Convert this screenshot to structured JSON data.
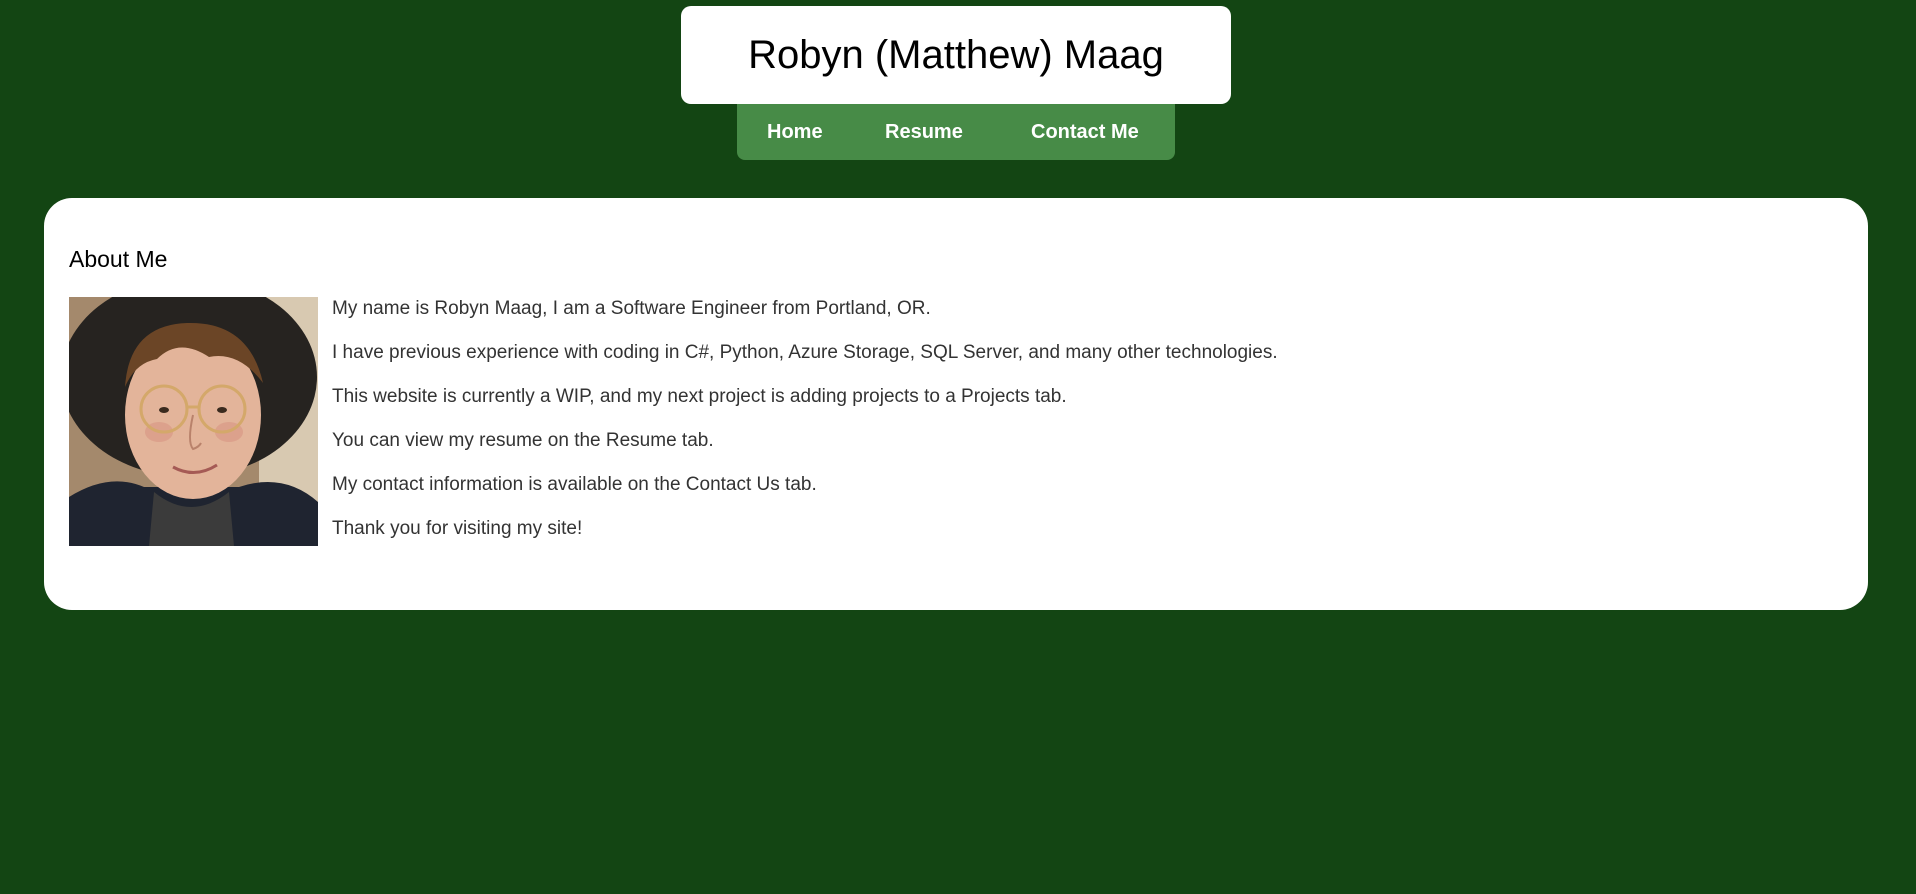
{
  "header": {
    "title": "Robyn (Matthew) Maag"
  },
  "nav": {
    "items": [
      {
        "label": "Home"
      },
      {
        "label": "Resume"
      },
      {
        "label": "Contact Me"
      }
    ]
  },
  "about": {
    "heading": "About Me",
    "photo_alt": "Portrait photo of Robyn Maag",
    "lines": [
      "My name is Robyn Maag, I am a Software Engineer from Portland, OR.",
      "I have previous experience with coding in C#, Python, Azure Storage, SQL Server, and many other technologies.",
      "This website is currently a WIP, and my next project is adding projects to a Projects tab.",
      "You can view my resume on the Resume tab.",
      "My contact information is available on the Contact Us tab.",
      "Thank you for visiting my site!"
    ]
  },
  "colors": {
    "page_background": "#134513",
    "nav_background": "#478b47",
    "card_background": "#ffffff"
  }
}
